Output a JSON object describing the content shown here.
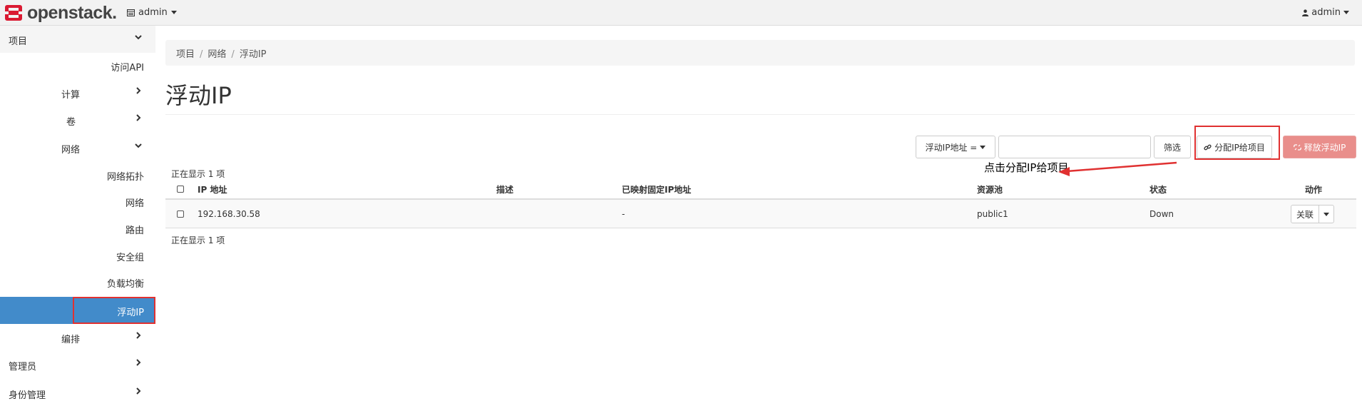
{
  "topbar": {
    "logo_text": "openstack.",
    "project_switch": "admin",
    "user": "admin"
  },
  "sidebar": {
    "items": [
      {
        "label": "项目",
        "icon": "chevron-down-icon"
      },
      {
        "label": "访问API"
      },
      {
        "label": "计算",
        "icon": "chevron-right-icon"
      },
      {
        "label": "卷",
        "icon": "chevron-right-icon"
      },
      {
        "label": "网络",
        "icon": "chevron-down-icon"
      },
      {
        "label": "网络拓扑"
      },
      {
        "label": "网络"
      },
      {
        "label": "路由"
      },
      {
        "label": "安全组"
      },
      {
        "label": "负载均衡"
      },
      {
        "label": "浮动IP"
      },
      {
        "label": "编排",
        "icon": "chevron-right-icon"
      },
      {
        "label": "管理员",
        "icon": "chevron-right-icon"
      },
      {
        "label": "身份管理",
        "icon": "chevron-right-icon"
      }
    ]
  },
  "breadcrumb": [
    "项目",
    "网络",
    "浮动IP"
  ],
  "page_title": "浮动IP",
  "toolbar": {
    "filter_select": "浮动IP地址 =",
    "filter_input_value": "",
    "filter_button": "筛选",
    "allocate_button": "分配IP给项目",
    "release_button": "释放浮动IP"
  },
  "annotation": "点击分配IP给项目",
  "count_text": "正在显示 1 项",
  "table": {
    "headers": [
      "IP 地址",
      "描述",
      "已映射固定IP地址",
      "资源池",
      "状态",
      "动作"
    ],
    "rows": [
      {
        "ip": "192.168.30.58",
        "description": "",
        "fixed_ip": "-",
        "pool": "public1",
        "status": "Down",
        "action": "关联"
      }
    ]
  },
  "colors": {
    "accent": "#428bca",
    "danger": "#e98e8b",
    "annotation_red": "#e03131",
    "logo_red": "#da1a32"
  }
}
